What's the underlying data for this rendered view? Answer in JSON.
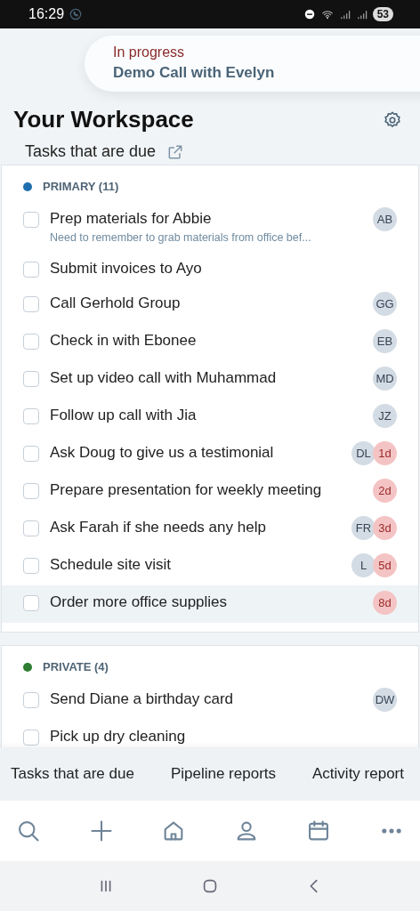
{
  "status_bar": {
    "time": "16:29",
    "battery": "53"
  },
  "banner": {
    "status": "In progress",
    "title": "Demo Call with Evelyn"
  },
  "header": {
    "title": "Your Workspace",
    "subtitle": "Tasks that are due"
  },
  "sections": [
    {
      "name": "PRIMARY (11)",
      "color": "#1f6fb0",
      "tasks": [
        {
          "title": "Prep materials for Abbie",
          "note": "Need to remember to grab materials from office bef...",
          "avatar": "AB",
          "checked": false,
          "selected": false
        },
        {
          "title": "Submit invoices to Ayo",
          "checked": false,
          "selected": false
        },
        {
          "title": "Call Gerhold Group",
          "avatar": "GG",
          "checked": false,
          "selected": false
        },
        {
          "title": "Check in with Ebonee",
          "avatar": "EB",
          "checked": false,
          "selected": false
        },
        {
          "title": "Set up video call with Muhammad",
          "avatar": "MD",
          "checked": false,
          "selected": false
        },
        {
          "title": "Follow up call with Jia",
          "avatar": "JZ",
          "checked": false,
          "selected": false
        },
        {
          "title": "Ask Doug to give us a testimonial",
          "avatar": "DL",
          "due": "1d",
          "checked": false,
          "selected": false
        },
        {
          "title": "Prepare presentation for weekly meeting",
          "due": "2d",
          "checked": false,
          "selected": false
        },
        {
          "title": "Ask Farah if she needs any help",
          "avatar": "FR",
          "due": "3d",
          "checked": false,
          "selected": false
        },
        {
          "title": "Schedule site visit",
          "avatar": "L",
          "due": "5d",
          "checked": false,
          "selected": false
        },
        {
          "title": "Order more office supplies",
          "due": "8d",
          "checked": false,
          "selected": true
        }
      ]
    },
    {
      "name": "PRIVATE (4)",
      "color": "#2e7d32",
      "tasks": [
        {
          "title": "Send Diane a birthday card",
          "avatar": "DW",
          "checked": false,
          "selected": false
        },
        {
          "title": "Pick up dry cleaning",
          "checked": false,
          "selected": false
        }
      ]
    }
  ],
  "report_tabs": [
    {
      "label": "Tasks that are due"
    },
    {
      "label": "Pipeline reports"
    },
    {
      "label": "Activity report"
    }
  ],
  "nav": [
    {
      "kind": "search"
    },
    {
      "kind": "add"
    },
    {
      "kind": "home"
    },
    {
      "kind": "person"
    },
    {
      "kind": "calendar"
    },
    {
      "kind": "more"
    }
  ]
}
